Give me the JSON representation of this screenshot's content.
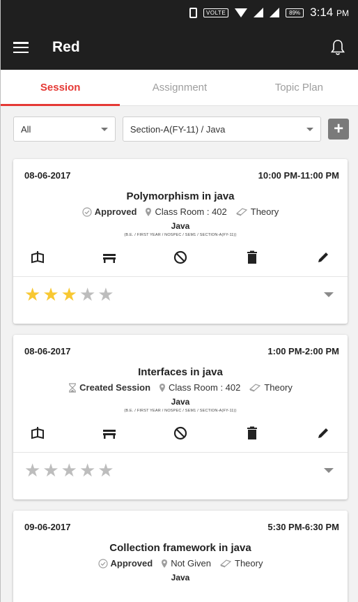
{
  "status_bar": {
    "volte": "VOLTE",
    "battery": "89%",
    "time": "3:14",
    "ampm": "PM"
  },
  "app_bar": {
    "title": "Red"
  },
  "tabs": [
    {
      "label": "Session",
      "active": true
    },
    {
      "label": "Assignment",
      "active": false
    },
    {
      "label": "Topic Plan",
      "active": false
    }
  ],
  "filters": {
    "type_value": "All",
    "section_value": "Section-A(FY-11) / Java",
    "add_label": "+"
  },
  "sessions": [
    {
      "date": "08-06-2017",
      "time": "10:00 PM-11:00 PM",
      "title": "Polymorphism in java",
      "status": "Approved",
      "location": "Class Room : 402",
      "kind": "Theory",
      "subject": "Java",
      "detail": "(B.E. / FIRST YEAR / NOSPEC / SEM1 / SECTION-A(FY-11))",
      "rating": 3
    },
    {
      "date": "08-06-2017",
      "time": "1:00 PM-2:00 PM",
      "title": "Interfaces in java",
      "status": "Created Session",
      "location": "Class Room : 402",
      "kind": "Theory",
      "subject": "Java",
      "detail": "(B.E. / FIRST YEAR / NOSPEC / SEM1 / SECTION-A(FY-11))",
      "rating": 0
    },
    {
      "date": "09-06-2017",
      "time": "5:30 PM-6:30 PM",
      "title": "Collection framework in java",
      "status": "Approved",
      "location": "Not Given",
      "kind": "Theory",
      "subject": "Java"
    }
  ],
  "icons": {
    "status_approved": "check-circle-icon",
    "status_created": "hourglass-icon",
    "location": "map-pin-icon",
    "kind": "book-icon",
    "actions": [
      "book-open-icon",
      "bench-icon",
      "cancel-icon",
      "delete-icon",
      "edit-pencil-icon"
    ]
  },
  "colors": {
    "accent": "#e53935",
    "star_on": "#f8c832",
    "star_off": "#bdbdbd",
    "app_bar": "#1f1f1f"
  }
}
